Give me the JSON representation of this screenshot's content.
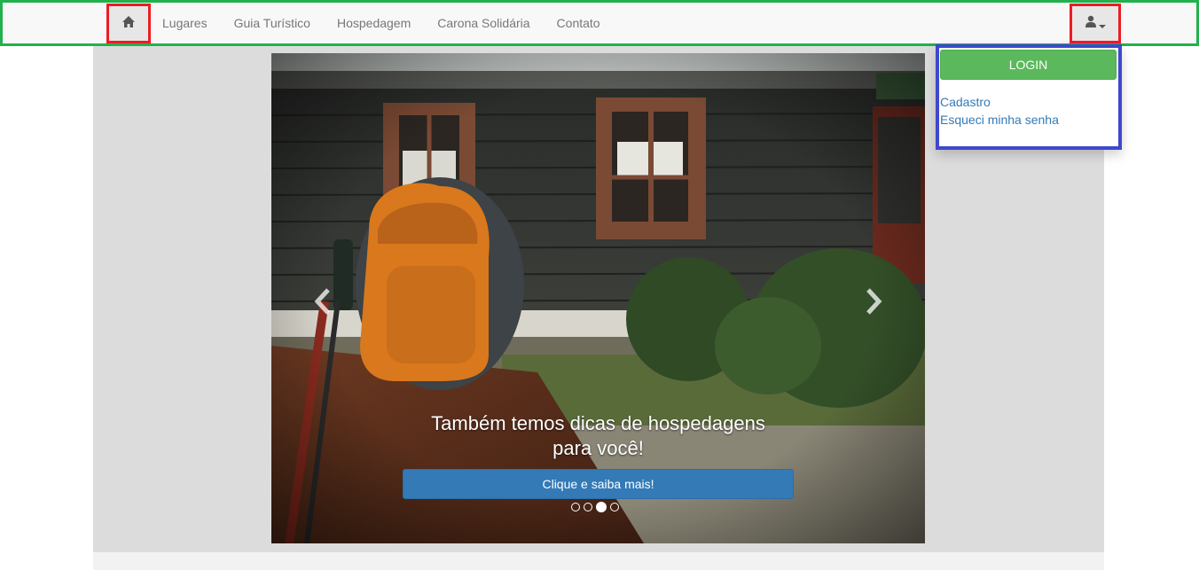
{
  "navbar": {
    "home_icon": "home-icon",
    "links": [
      {
        "label": "Lugares"
      },
      {
        "label": "Guia Turístico"
      },
      {
        "label": "Hospedagem"
      },
      {
        "label": "Carona Solidária"
      },
      {
        "label": "Contato"
      }
    ],
    "user_icon": "user-icon"
  },
  "carousel": {
    "caption_line1": "Também temos dicas de hospedagens",
    "caption_line2": "para você!",
    "cta_label": "Clique e saiba mais!",
    "prev_icon": "chevron-left-icon",
    "next_icon": "chevron-right-icon",
    "indicator_count": 4,
    "active_index": 2
  },
  "dropdown": {
    "login_label": "LOGIN",
    "register_label": "Cadastro",
    "forgot_label": "Esqueci minha senha"
  },
  "colors": {
    "navbar_border": "#22b14c",
    "highlight_red": "#ed1c24",
    "dropdown_border": "#3f48cc",
    "login_green": "#5cb85c",
    "cta_blue": "#337ab7"
  }
}
